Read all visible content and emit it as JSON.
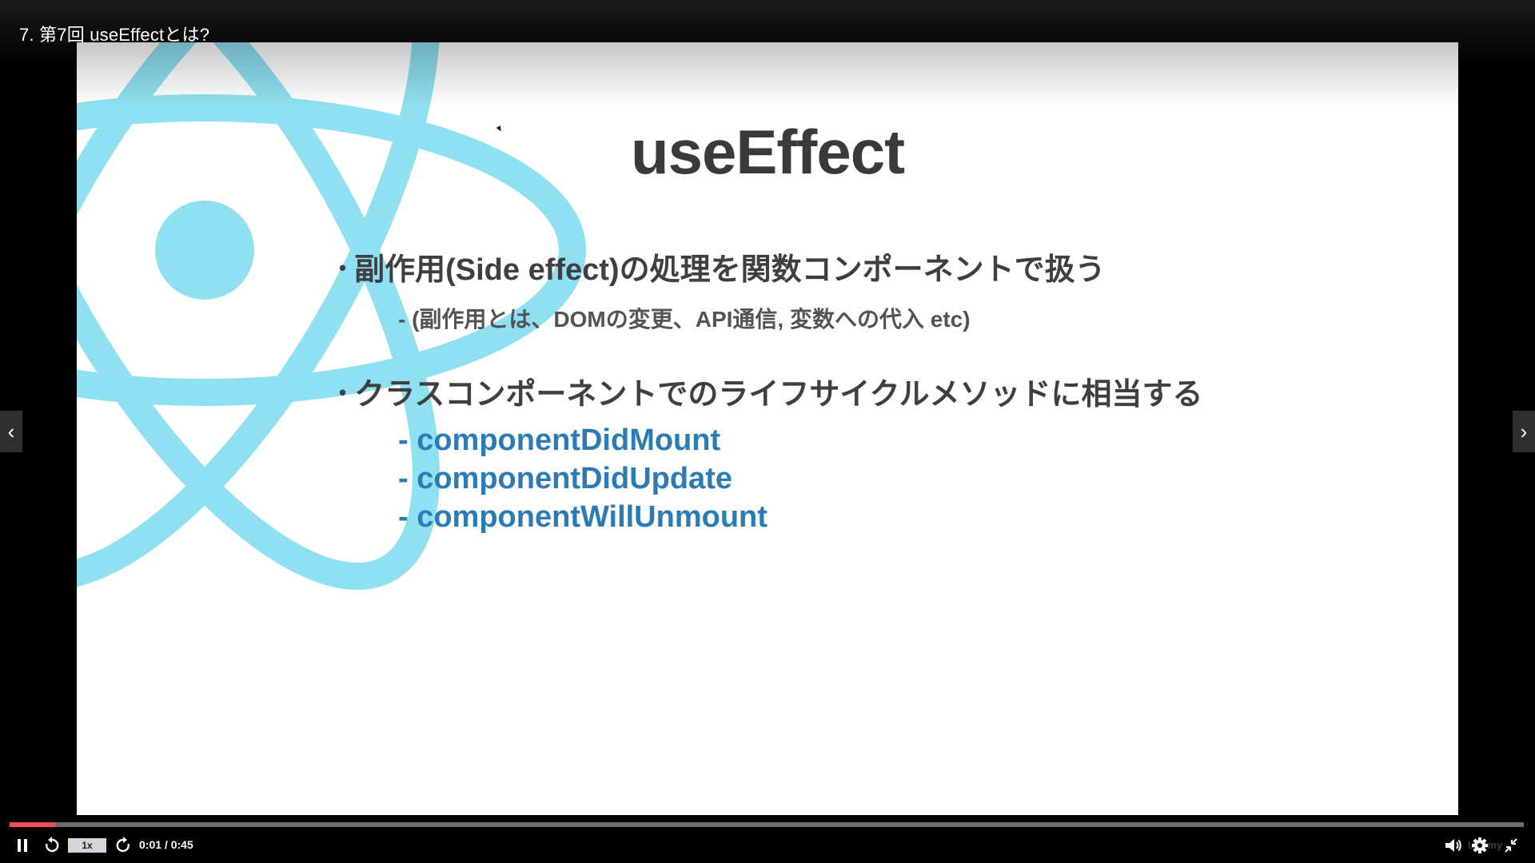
{
  "lecture": {
    "title": "7. 第7回 useEffectとは?"
  },
  "slide": {
    "heading": "useEffect",
    "bullet_marker": "•",
    "bullets": [
      {
        "text": "副作用(Side effect)の処理を関数コンポーネントで扱う",
        "sub": "- (副作用とは、DOMの変更、API通信, 変数への代入 etc)"
      },
      {
        "text": "クラスコンポーネントでのライフサイクルメソッドに相当する",
        "methods": [
          "- componentDidMount",
          "- componentDidUpdate",
          "- componentWillUnmount"
        ]
      }
    ],
    "logo": "react-atom-logo",
    "colors": {
      "heading": "#3a3a3c",
      "methods": "#2b7bb5",
      "logo": "#8fe0f0"
    }
  },
  "navigation": {
    "prev_icon": "‹",
    "next_icon": "›"
  },
  "controls": {
    "speed": "1x",
    "current_time": "0:01",
    "duration": "0:45",
    "time_separator": " / ",
    "progress": 0.03,
    "brand": "Udemy",
    "icons": [
      "pause-icon",
      "rewind-icon",
      "forward-icon",
      "volume-icon",
      "settings-icon",
      "exit-fullscreen-icon"
    ],
    "progress_color": "#ec5252"
  }
}
